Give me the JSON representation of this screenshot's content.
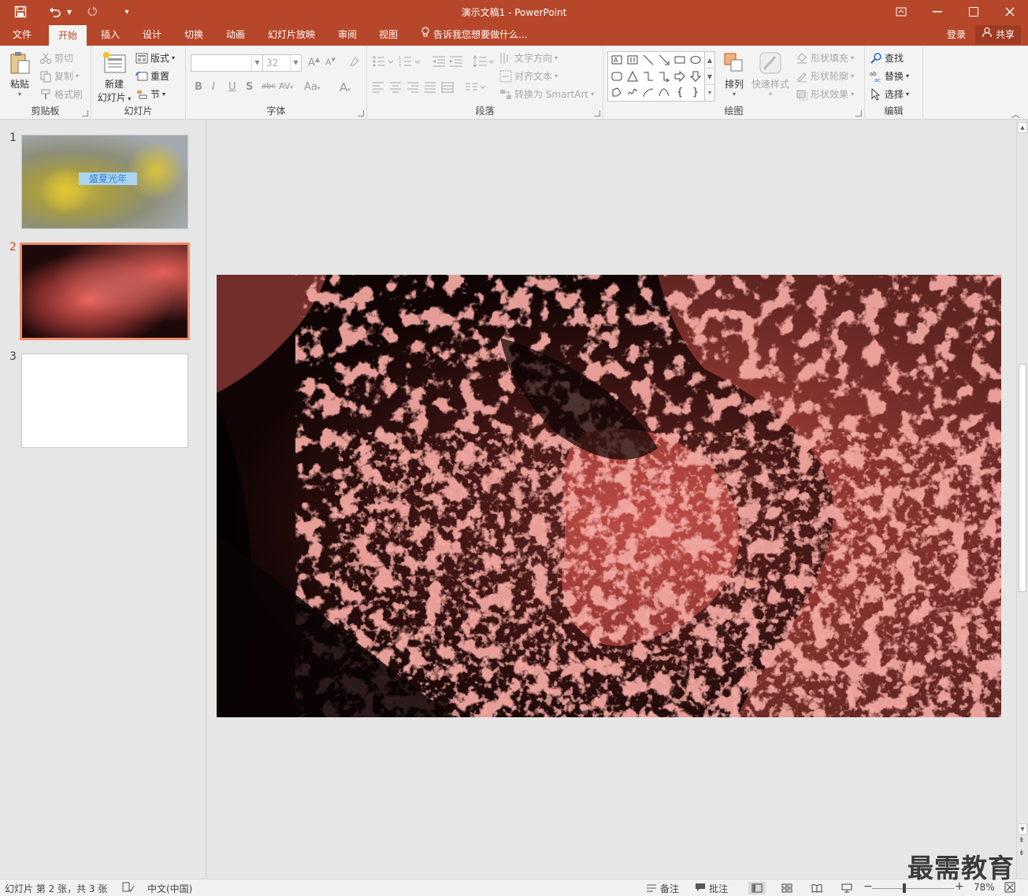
{
  "window": {
    "title": "演示文稿1 - PowerPoint"
  },
  "tabs": [
    {
      "label": "文件"
    },
    {
      "label": "开始"
    },
    {
      "label": "插入"
    },
    {
      "label": "设计"
    },
    {
      "label": "切换"
    },
    {
      "label": "动画"
    },
    {
      "label": "幻灯片放映"
    },
    {
      "label": "审阅"
    },
    {
      "label": "视图"
    }
  ],
  "tell_me": "告诉我您想要做什么...",
  "account": {
    "login": "登录",
    "share": "共享"
  },
  "ribbon": {
    "clipboard": {
      "label": "剪贴板",
      "paste": "粘贴",
      "cut": "剪切",
      "copy": "复制",
      "format_painter": "格式刷"
    },
    "slides": {
      "label": "幻灯片",
      "new_slide_line1": "新建",
      "new_slide_line2": "幻灯片",
      "layout": "版式",
      "reset": "重置",
      "section": "节"
    },
    "font": {
      "label": "字体",
      "font_name": "",
      "font_size": "32"
    },
    "paragraph": {
      "label": "段落",
      "text_direction": "文字方向",
      "align_text": "对齐文本",
      "convert_smartart": "转换为 SmartArt"
    },
    "drawing": {
      "label": "绘图",
      "arrange": "排列",
      "quick_styles": "快速样式",
      "shape_fill": "形状填充",
      "shape_outline": "形状轮廓",
      "shape_effects": "形状效果"
    },
    "editing": {
      "label": "编辑",
      "find": "查找",
      "replace": "替换",
      "select": "选择"
    }
  },
  "thumbnails": [
    {
      "number": "1",
      "title_text": "盛夏光年"
    },
    {
      "number": "2"
    },
    {
      "number": "3"
    }
  ],
  "status": {
    "slide_info": "幻灯片 第 2 张，共 3 张",
    "language": "中文(中国)",
    "notes": "备注",
    "comments": "批注",
    "zoom": "78%"
  },
  "watermark": "最需教育",
  "colors": {
    "accent": "#b7472a",
    "selected_thumb_border": "#ef8a6b",
    "slide_tint": "#e0605a"
  }
}
